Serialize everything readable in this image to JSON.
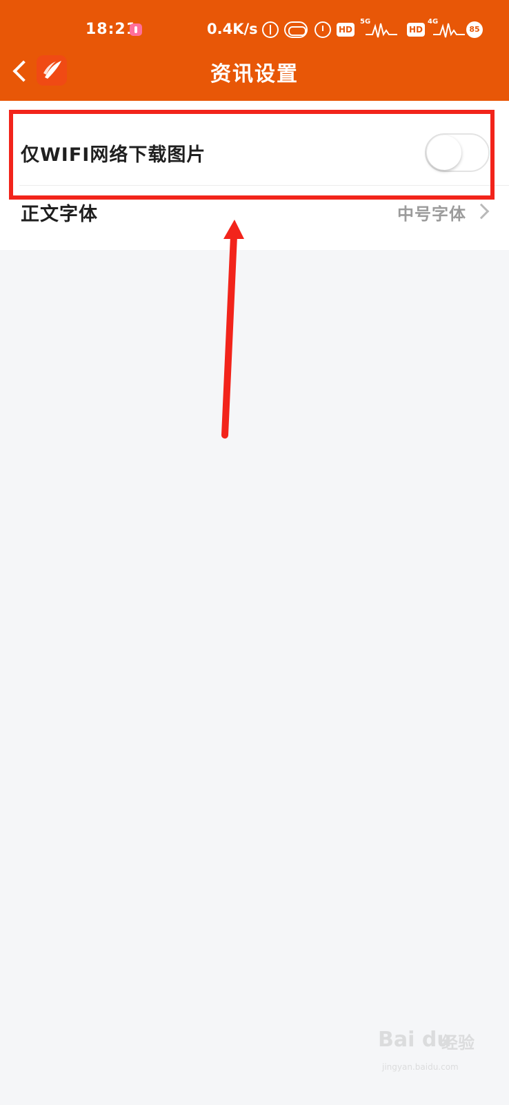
{
  "status_bar": {
    "time": "18:21",
    "network_speed": "0.4K/s",
    "hd_label": "HD",
    "network_type_1": "5G",
    "network_type_2": "4G",
    "battery": "85"
  },
  "nav": {
    "title": "资讯设置"
  },
  "settings": {
    "wifi_images": {
      "label": "仅WIFI网络下载图片",
      "enabled": false
    },
    "body_font": {
      "label": "正文字体",
      "value": "中号字体"
    }
  },
  "watermark": {
    "brand": "Bai du",
    "brand_cn": "经验",
    "url": "jingyan.baidu.com"
  },
  "colors": {
    "header": "#e85707",
    "annotation": "#f2241b",
    "background": "#f5f6f8"
  }
}
